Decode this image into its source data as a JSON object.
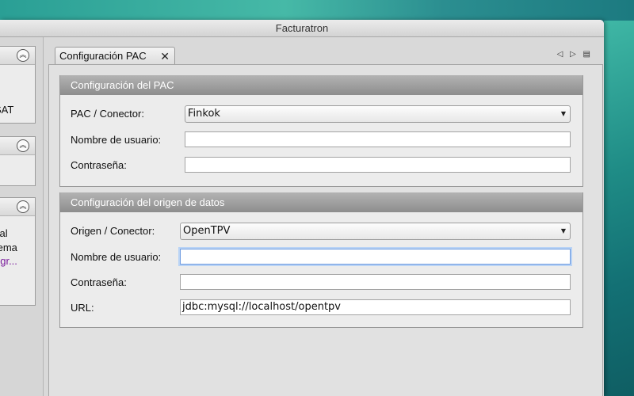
{
  "window": {
    "title": "Facturatron"
  },
  "sidebar": {
    "panels": [
      {
        "collapse_icon": "double-chevron-up-icon",
        "lines": [
          "SAT"
        ]
      },
      {
        "collapse_icon": "double-chevron-up-icon",
        "lines": []
      },
      {
        "collapse_icon": "double-chevron-up-icon",
        "lines": [
          "cal",
          "tema",
          "egr..."
        ]
      }
    ]
  },
  "tab": {
    "label": "Configuración PAC",
    "close_glyph": "✕"
  },
  "tab_controls": {
    "prev": "◁",
    "next": "▷",
    "menu": "▤"
  },
  "pac_group": {
    "title": "Configuración del PAC",
    "connector_label": "PAC / Conector:",
    "connector_value": "Finkok",
    "username_label": "Nombre de usuario:",
    "username_value": "",
    "password_label": "Contraseña:",
    "password_value": ""
  },
  "datasource_group": {
    "title": "Configuración del origen de datos",
    "connector_label": "Origen / Conector:",
    "connector_value": "OpenTPV",
    "username_label": "Nombre de usuario:",
    "username_value": "",
    "password_label": "Contraseña:",
    "password_value": "",
    "url_label": "URL:",
    "url_value": "jdbc:mysql://localhost/opentpv"
  },
  "colors": {
    "group_header": "#8d8d8d",
    "focus_ring": "#6e9be0",
    "link": "#7a1c9c"
  }
}
